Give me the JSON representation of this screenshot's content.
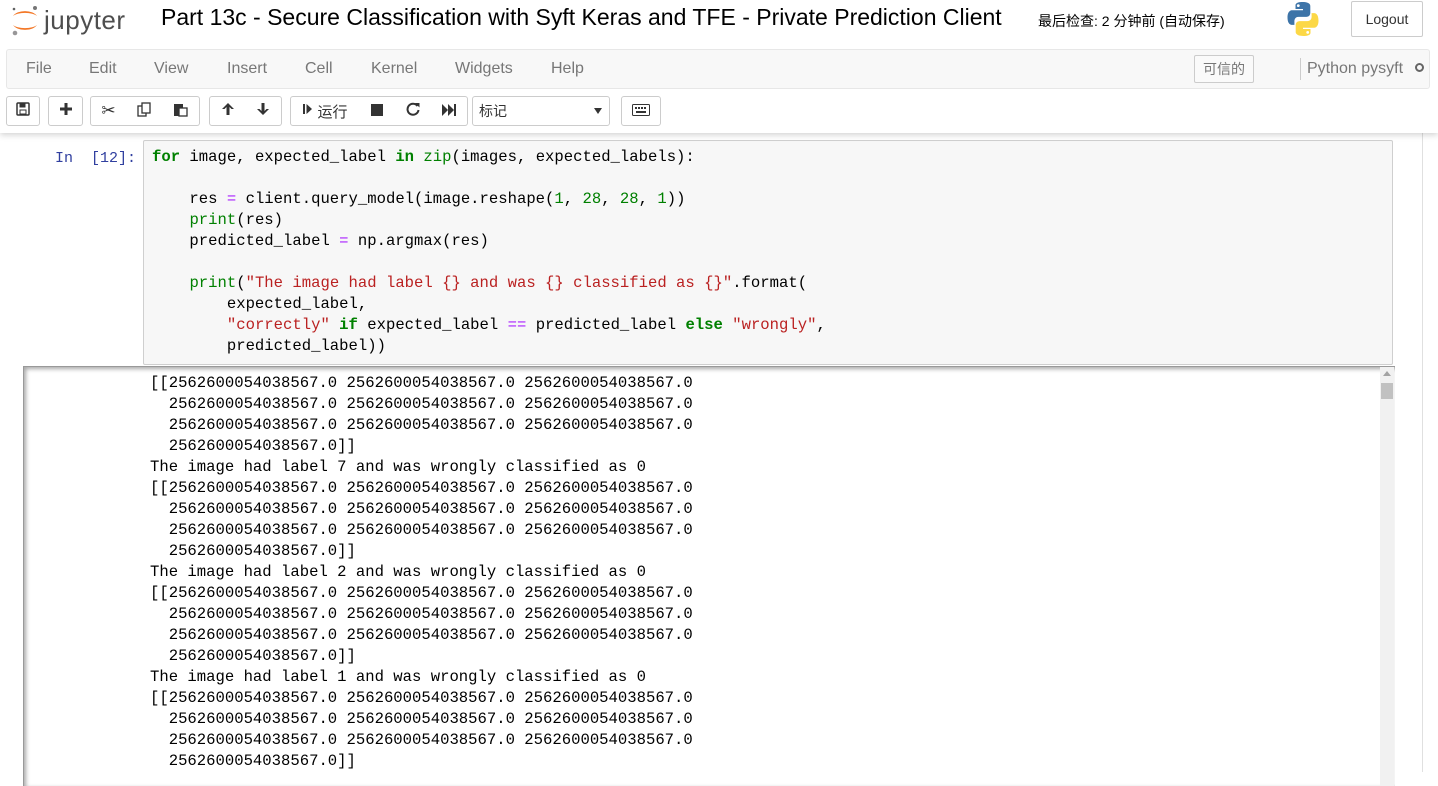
{
  "header": {
    "logo_text": "jupyter",
    "notebook_title": "Part 13c - Secure Classification with Syft Keras and TFE - Private Prediction Client",
    "save_status": "最后检查: 2 分钟前  (自动保存)",
    "logout_label": "Logout"
  },
  "menubar": {
    "items": [
      "File",
      "Edit",
      "View",
      "Insert",
      "Cell",
      "Kernel",
      "Widgets",
      "Help"
    ],
    "trusted_label": "可信的",
    "kernel_name": "Python pysyft"
  },
  "toolbar": {
    "run_label": "运行",
    "cell_type": "标记",
    "icons": [
      "save-icon",
      "plus-icon",
      "cut-icon",
      "copy-icon",
      "paste-icon",
      "arrow-up-icon",
      "arrow-down-icon",
      "run-icon",
      "stop-icon",
      "restart-icon",
      "fast-forward-icon",
      "keyboard-icon"
    ]
  },
  "cell": {
    "prompt": "In  [12]:",
    "code_lines": [
      "for image, expected_label in zip(images, expected_labels):",
      "",
      "    res = client.query_model(image.reshape(1, 28, 28, 1))",
      "    print(res)",
      "    predicted_label = np.argmax(res)",
      "",
      "    print(\"The image had label {} and was {} classified as {}\".format(",
      "        expected_label,",
      "        \"correctly\" if expected_label == predicted_label else \"wrongly\",",
      "        predicted_label))"
    ],
    "output_lines": [
      "[[2562600054038567.0 2562600054038567.0 2562600054038567.0",
      "  2562600054038567.0 2562600054038567.0 2562600054038567.0",
      "  2562600054038567.0 2562600054038567.0 2562600054038567.0",
      "  2562600054038567.0]]",
      "The image had label 7 and was wrongly classified as 0",
      "[[2562600054038567.0 2562600054038567.0 2562600054038567.0",
      "  2562600054038567.0 2562600054038567.0 2562600054038567.0",
      "  2562600054038567.0 2562600054038567.0 2562600054038567.0",
      "  2562600054038567.0]]",
      "The image had label 2 and was wrongly classified as 0",
      "[[2562600054038567.0 2562600054038567.0 2562600054038567.0",
      "  2562600054038567.0 2562600054038567.0 2562600054038567.0",
      "  2562600054038567.0 2562600054038567.0 2562600054038567.0",
      "  2562600054038567.0]]",
      "The image had label 1 and was wrongly classified as 0",
      "[[2562600054038567.0 2562600054038567.0 2562600054038567.0",
      "  2562600054038567.0 2562600054038567.0 2562600054038567.0",
      "  2562600054038567.0 2562600054038567.0 2562600054038567.0",
      "  2562600054038567.0]]"
    ]
  },
  "colors": {
    "prompt_in": "#303f9f",
    "keyword": "#008000",
    "string": "#ba2121",
    "operator": "#aa22ff",
    "menu_text": "#777777",
    "jupyter_orange": "#f37726"
  }
}
